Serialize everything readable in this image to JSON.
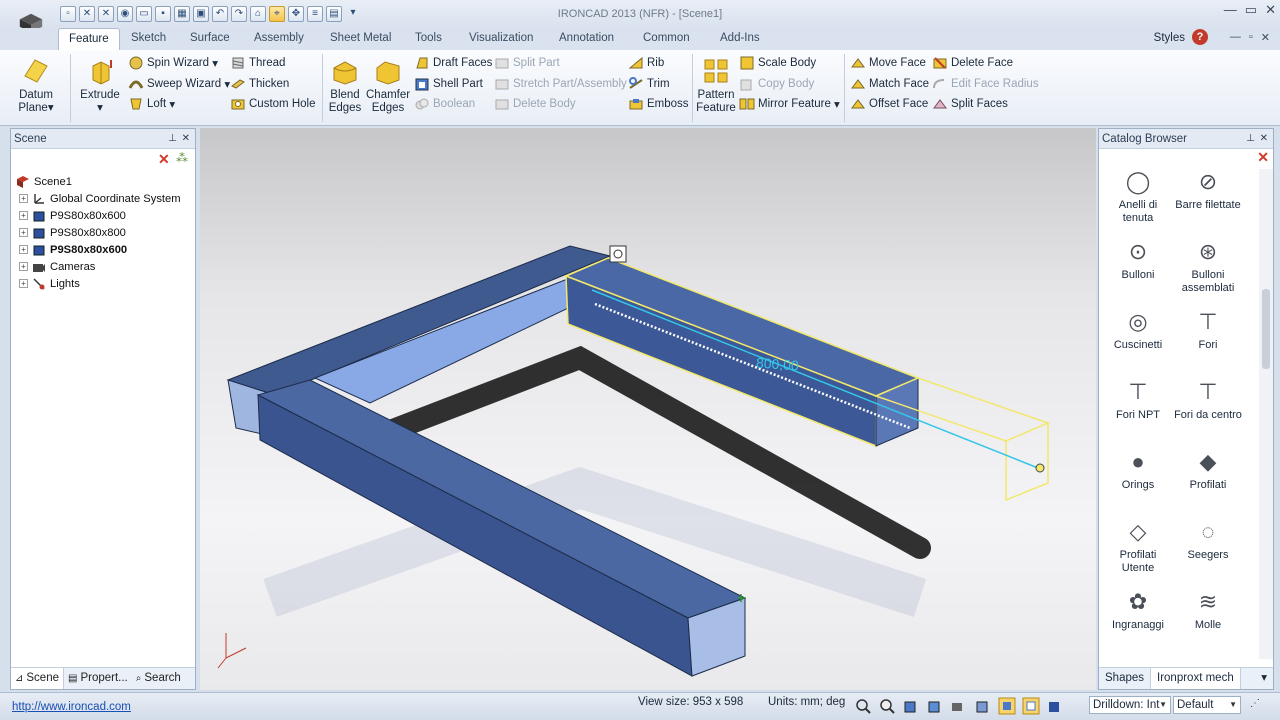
{
  "window": {
    "title": "IRONCAD 2013 (NFR) - [Scene1]"
  },
  "ribbon_tabs": [
    "Feature",
    "Sketch",
    "Surface",
    "Assembly",
    "Sheet Metal",
    "Tools",
    "Visualization",
    "Annotation",
    "Common",
    "Add-Ins"
  ],
  "active_tab": "Feature",
  "styles_label": "Styles",
  "ribbon": {
    "datum_plane": [
      "Datum",
      "Plane"
    ],
    "extrude": "Extrude",
    "spin_wizard": "Spin Wizard",
    "sweep_wizard": "Sweep Wizard",
    "loft": "Loft",
    "thread": "Thread",
    "thicken": "Thicken",
    "custom_hole": "Custom Hole",
    "blend_edges": [
      "Blend",
      "Edges"
    ],
    "chamfer_edges": [
      "Chamfer",
      "Edges"
    ],
    "draft_faces": "Draft Faces",
    "shell_part": "Shell Part",
    "boolean": "Boolean",
    "split_part": "Split Part",
    "stretch_part": "Stretch Part/Assembly",
    "delete_body": "Delete Body",
    "rib": "Rib",
    "trim": "Trim",
    "emboss": "Emboss",
    "pattern_feature": [
      "Pattern",
      "Feature"
    ],
    "scale_body": "Scale Body",
    "copy_body": "Copy Body",
    "mirror_feature": "Mirror Feature",
    "move_face": "Move Face",
    "match_face": "Match Face",
    "offset_face": "Offset Face",
    "delete_face": "Delete Face",
    "edit_face_radius": "Edit Face Radius",
    "split_faces": "Split Faces"
  },
  "scene_panel": {
    "title": "Scene",
    "items": [
      {
        "label": "Scene1",
        "bold": false
      },
      {
        "label": "Global Coordinate System",
        "bold": false
      },
      {
        "label": "P9S80x80x600",
        "bold": false
      },
      {
        "label": "P9S80x80x800",
        "bold": false
      },
      {
        "label": "P9S80x80x600",
        "bold": true
      },
      {
        "label": "Cameras",
        "bold": false
      },
      {
        "label": "Lights",
        "bold": false
      }
    ],
    "tabs": [
      "Scene",
      "Propert...",
      "Search"
    ]
  },
  "viewport": {
    "dimension_label": "800,00"
  },
  "catalog": {
    "title": "Catalog Browser",
    "items": [
      {
        "label": "Anelli di tenuta",
        "icon": "ring-icon"
      },
      {
        "label": "Barre filettate",
        "icon": "threaded-bar-icon"
      },
      {
        "label": "Bulloni",
        "icon": "bolt-icon"
      },
      {
        "label": "Bulloni assemblati",
        "icon": "bolt-assembly-icon"
      },
      {
        "label": "Cuscinetti",
        "icon": "bearing-icon"
      },
      {
        "label": "Fori",
        "icon": "hole-icon"
      },
      {
        "label": "Fori NPT",
        "icon": "npt-hole-icon"
      },
      {
        "label": "Fori da centro",
        "icon": "center-hole-icon"
      },
      {
        "label": "Orings",
        "icon": "oring-icon"
      },
      {
        "label": "Profilati",
        "icon": "profile-icon"
      },
      {
        "label": "Profilati Utente",
        "icon": "user-profile-icon"
      },
      {
        "label": "Seegers",
        "icon": "seeger-icon"
      },
      {
        "label": "Ingranaggi",
        "icon": "gear-icon"
      },
      {
        "label": "Molle",
        "icon": "spring-icon"
      }
    ],
    "tabs": [
      "Shapes",
      "Ironproxt mech"
    ]
  },
  "status": {
    "link": "http://www.ironcad.com",
    "view_size": "View size: 953 x 598",
    "units": "Units: mm; deg",
    "drilldown": "Drilldown: Int",
    "style": "Default"
  },
  "colors": {
    "accent": "#f4c24a",
    "part_blue": "#4a6aa8",
    "selection": "#f2e86b"
  }
}
